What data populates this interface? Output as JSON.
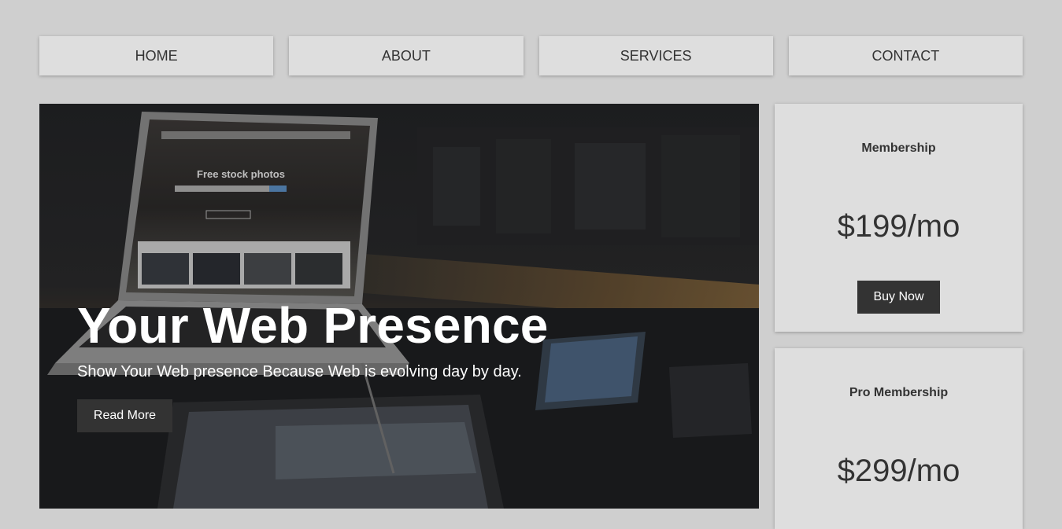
{
  "nav": {
    "items": [
      {
        "label": "HOME"
      },
      {
        "label": "ABOUT"
      },
      {
        "label": "SERVICES"
      },
      {
        "label": "CONTACT"
      }
    ]
  },
  "hero": {
    "title": "Your Web Presence",
    "subtitle": "Show Your Web presence Because Web is evolving day by day.",
    "button_label": "Read More",
    "photo_screen_text": "Free stock photos"
  },
  "pricing": [
    {
      "title": "Membership",
      "price": "$199/mo",
      "button_label": "Buy Now"
    },
    {
      "title": "Pro Membership",
      "price": "$299/mo"
    }
  ],
  "colors": {
    "page_background": "#cfcfcf",
    "panel_background": "#dedede",
    "button_dark": "#333333",
    "text_dark": "#333333",
    "hero_text": "#ffffff"
  }
}
